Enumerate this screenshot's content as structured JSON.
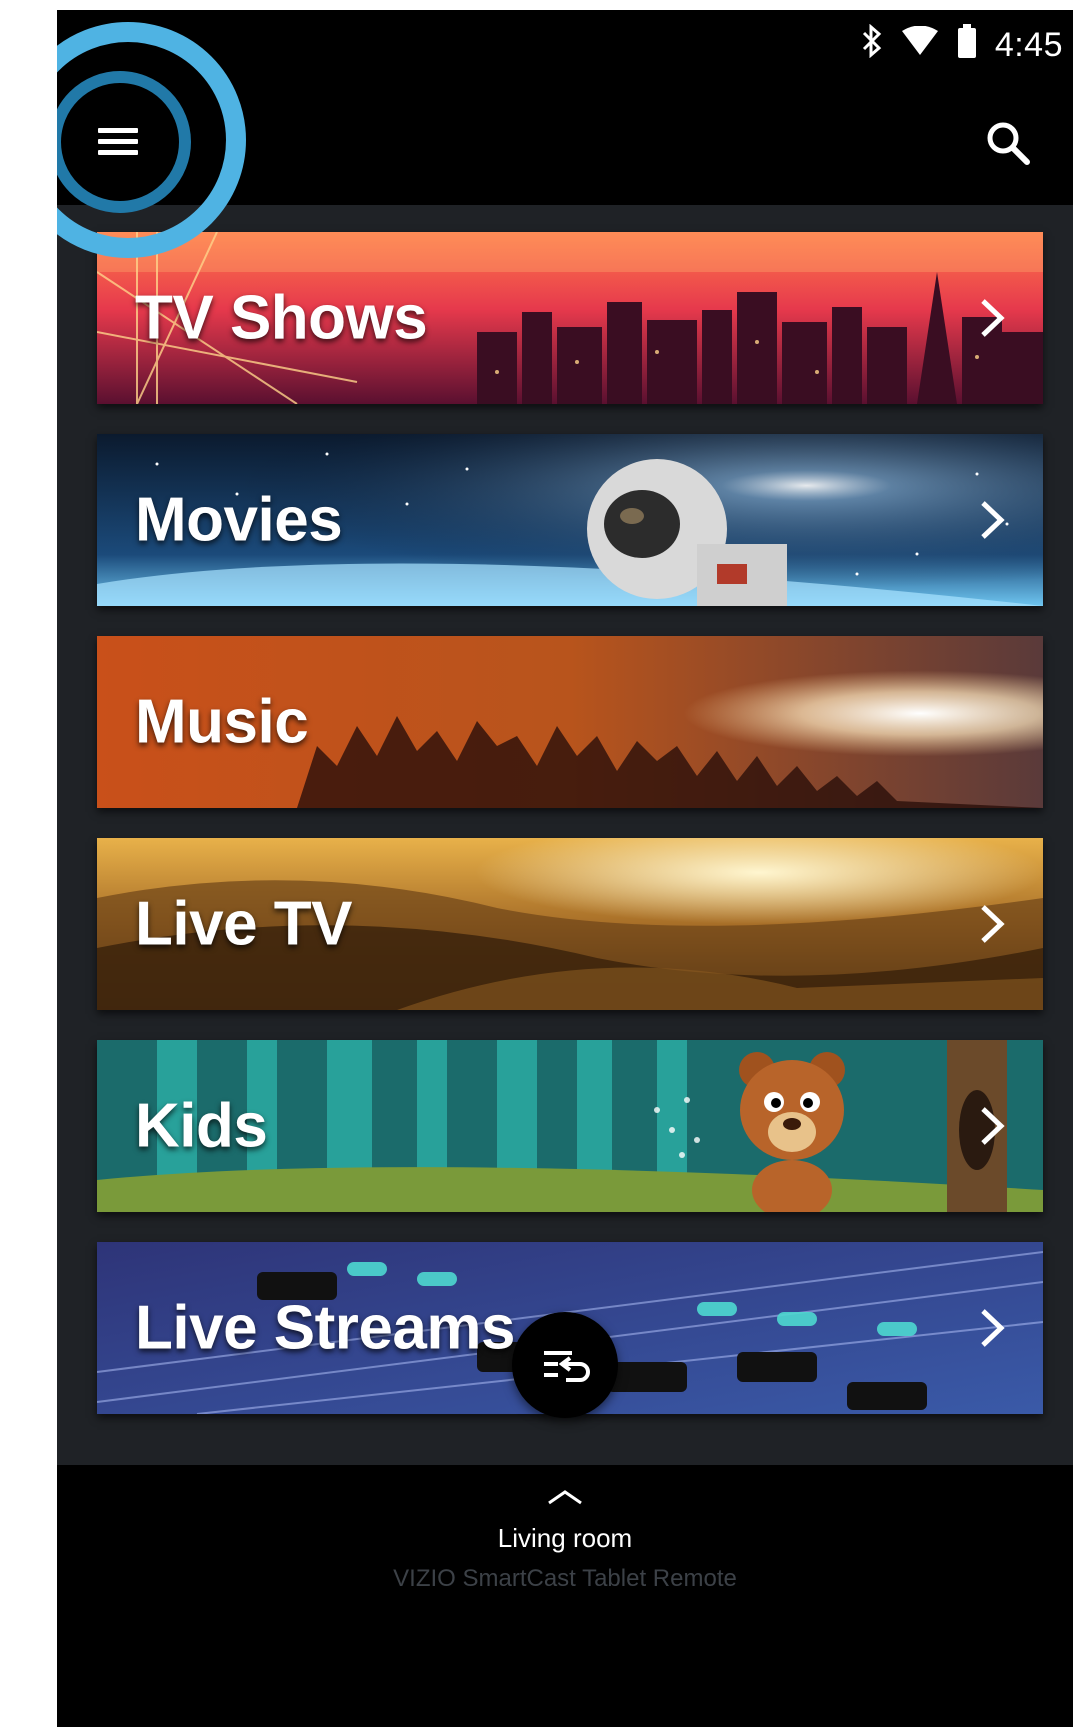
{
  "status_bar": {
    "time": "4:45",
    "icons": [
      "bluetooth-icon",
      "wifi-icon",
      "battery-icon"
    ]
  },
  "app_bar": {
    "menu_icon": "hamburger-menu-icon",
    "search_icon": "search-icon"
  },
  "categories": [
    {
      "label": "TV Shows"
    },
    {
      "label": "Movies"
    },
    {
      "label": "Music"
    },
    {
      "label": "Live TV"
    },
    {
      "label": "Kids"
    },
    {
      "label": "Live Streams"
    }
  ],
  "fab": {
    "icon": "input-switch-icon"
  },
  "bottom_bar": {
    "device_name": "Living room",
    "subtitle": "VIZIO SmartCast Tablet Remote"
  },
  "colors": {
    "background": "#1f2226",
    "bars": "#000000",
    "highlight_outer": "#4fb3e3",
    "highlight_inner": "#2179a8"
  }
}
